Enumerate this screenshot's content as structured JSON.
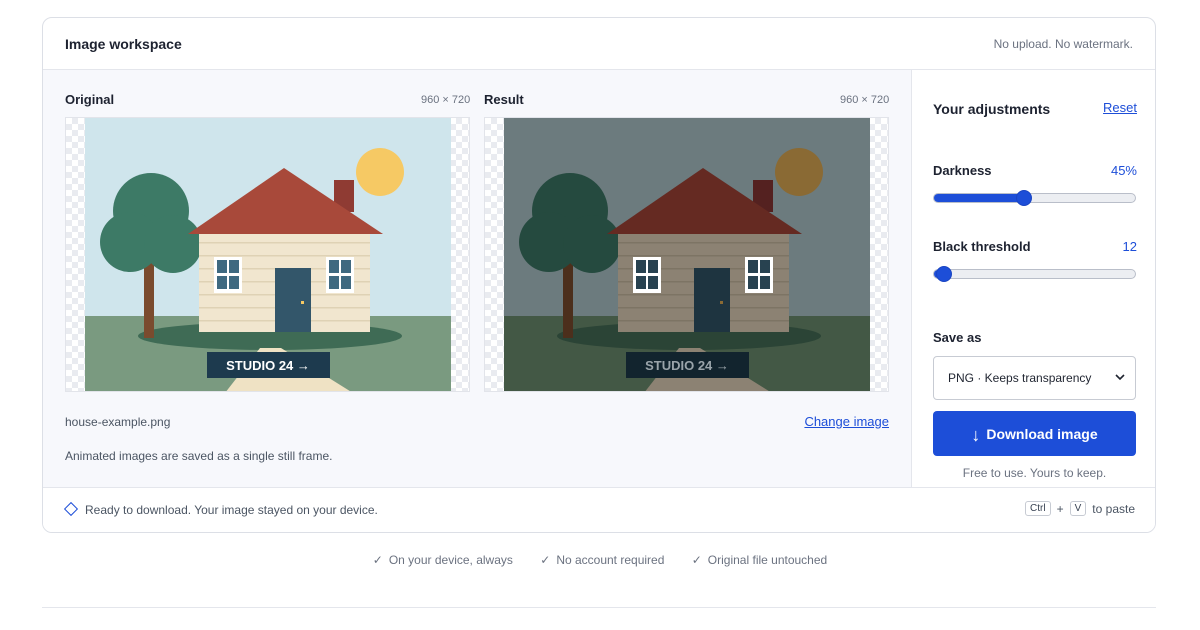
{
  "header": {
    "title": "Image workspace",
    "note": "No upload. No watermark."
  },
  "original": {
    "label": "Original",
    "dims": "960 × 720",
    "watermark": "STUDIO 24 →"
  },
  "result": {
    "label": "Result",
    "dims": "960 × 720",
    "watermark": "STUDIO 24 →"
  },
  "file": {
    "name": "house-example.png",
    "change_label": "Change image",
    "anim_note": "Animated images are saved as a single still frame."
  },
  "sidebar": {
    "title": "Your adjustments",
    "reset_label": "Reset",
    "darkness": {
      "label": "Darkness",
      "value_text": "45%",
      "value": 0.45
    },
    "threshold": {
      "label": "Black threshold",
      "value_text": "12",
      "value": 0.05
    },
    "save_as_label": "Save as",
    "format_selected": "PNG · Keeps transparency",
    "download_label": "Download image",
    "free_note": "Free to use. Yours to keep."
  },
  "footer": {
    "status": "Ready to download. Your image stayed on your device.",
    "key1": "Ctrl",
    "plus": "+",
    "key2": "V",
    "paste_suffix": "to paste"
  },
  "trust": [
    "On your device, always",
    "No account required",
    "Original file untouched"
  ],
  "colors": {
    "accent": "#1d4ed8",
    "original": {
      "sky": "#cfe5ec",
      "ground": "#7a9a80",
      "roof": "#a8493a",
      "chimney": "#8f3b33",
      "wall": "#f1e6cf",
      "siding": "#dfd2b5",
      "door": "#33566a",
      "window": "#3f6980",
      "trunk": "#7a4b2e",
      "tree": "#3d7a66",
      "sun": "#f6c964",
      "lawn": "#3f6b55",
      "path": "#efe2c4",
      "badge": "#1d3a4e"
    },
    "result": {
      "sky": "#6c7b7e",
      "ground": "#435845",
      "roof": "#652a22",
      "chimney": "#542120",
      "wall": "#8c8273",
      "siding": "#7d7464",
      "door": "#1e3440",
      "window": "#284250",
      "trunk": "#4c2f1c",
      "tree": "#254a3f",
      "sun": "#8a6a34",
      "lawn": "#2b4436",
      "path": "#8c8273",
      "badge": "#12242e"
    }
  }
}
